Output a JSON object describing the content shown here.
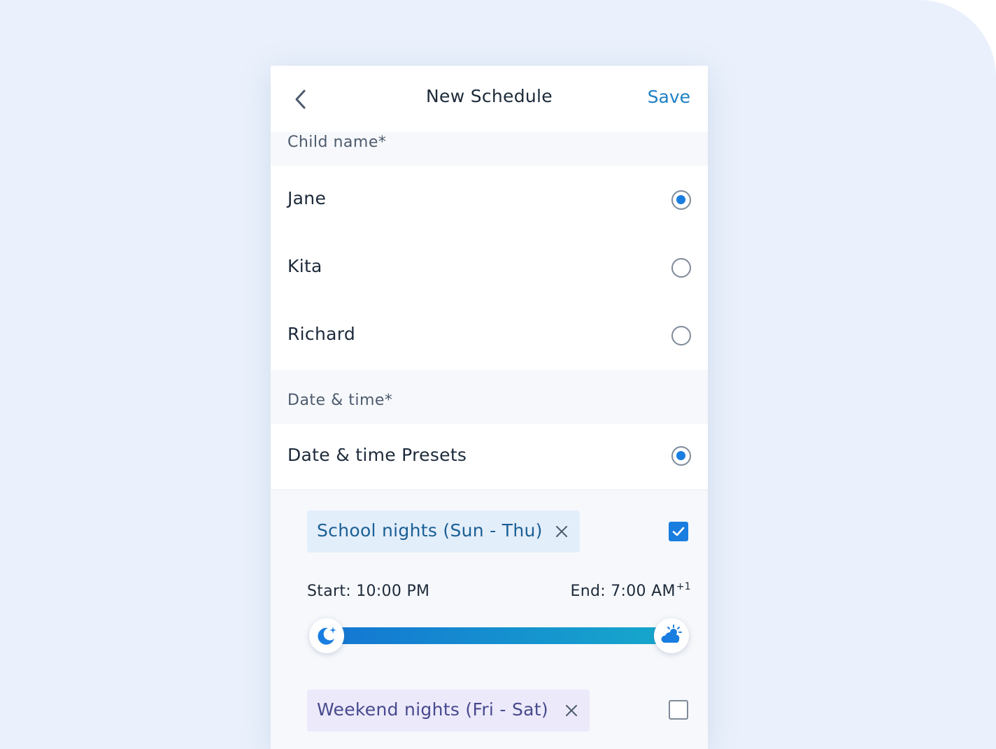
{
  "header": {
    "title": "New Schedule",
    "save_label": "Save"
  },
  "child_section": {
    "label": "Child name*",
    "options": [
      {
        "name": "Jane",
        "selected": true
      },
      {
        "name": "Kita",
        "selected": false
      },
      {
        "name": "Richard",
        "selected": false
      }
    ]
  },
  "datetime_section": {
    "label": "Date & time*",
    "preset_option": {
      "label": "Date & time Presets",
      "selected": true
    }
  },
  "presets": [
    {
      "label": "School nights (Sun - Thu)",
      "checked": true,
      "start": "Start: 10:00 PM",
      "end": "End: 7:00 AM",
      "end_suffix": "+1"
    },
    {
      "label": "Weekend nights (Fri - Sat)",
      "checked": false
    }
  ],
  "icons": {
    "back": "chevron-left-icon",
    "start_knob": "moon-icon",
    "end_knob": "sun-cloud-icon",
    "chip_remove": "close-icon",
    "checkbox": "checkmark-icon"
  },
  "colors": {
    "accent": "#1a7de0",
    "save": "#1d80c4",
    "slider_start": "#1478d2",
    "slider_end": "#16a6cc"
  }
}
